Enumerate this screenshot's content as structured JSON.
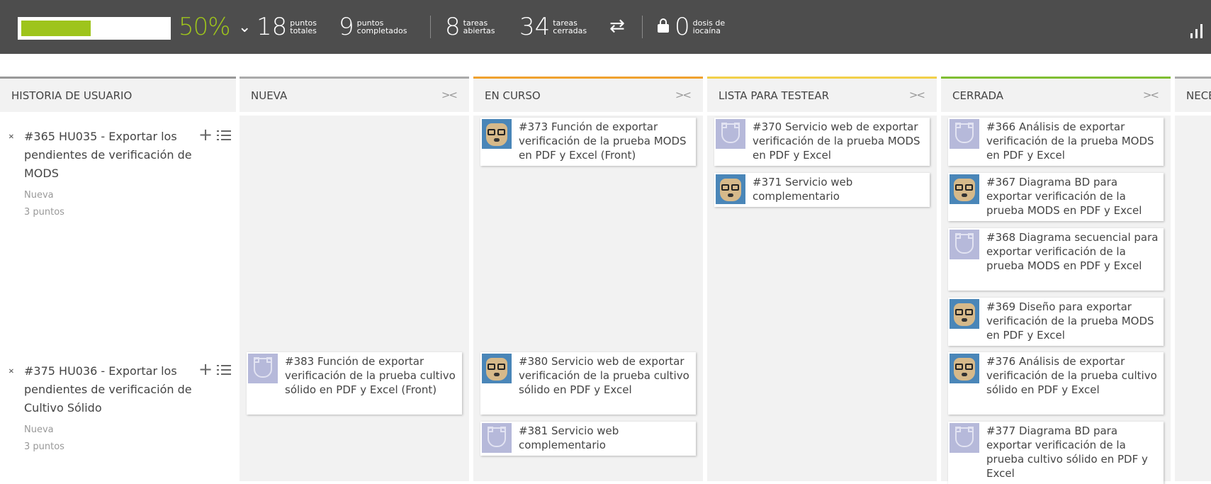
{
  "progress": {
    "percent_label": "50%",
    "fraction": 0.5
  },
  "stats": {
    "total_points": {
      "value": "18",
      "line1": "puntos",
      "line2": "totales"
    },
    "completed_points": {
      "value": "9",
      "line1": "puntos",
      "line2": "completados"
    },
    "open_tasks": {
      "value": "8",
      "line1": "tareas",
      "line2": "abiertas"
    },
    "closed_tasks": {
      "value": "34",
      "line1": "tareas",
      "line2": "cerradas"
    },
    "iocaine": {
      "value": "0",
      "line1": "dosis de",
      "line2": "iocaína"
    }
  },
  "icons": {
    "expand": "chevron-down-icon",
    "swap": "swap-arrows-icon",
    "lock": "lock-icon",
    "graph": "bar-graph-icon",
    "fold": "fold-column-icon",
    "add": "plus-icon",
    "list": "list-icon",
    "toggle": "collapse-toggle-icon"
  },
  "colors": {
    "topbar": "#4d4d4d",
    "progress_green": "#9ec41c",
    "column_bg": "#f2f2f2",
    "nueva_border": "#aaaaaa",
    "en_curso_border": "#f0a22f",
    "lista_border": "#f2d04a",
    "cerrada_border": "#7fbe32"
  },
  "columns": {
    "story": "HISTORIA DE USUARIO",
    "nueva": "NUEVA",
    "en_curso": "EN CURSO",
    "lista": "LISTA PARA TESTEAR",
    "cerrada": "CERRADA",
    "next": "NECE",
    "fold_symbol": "><"
  },
  "stories": [
    {
      "title": "#365 HU035 - Exportar los pendientes de verificación de MODS",
      "status": "Nueva",
      "points": "3 puntos",
      "tasks": {
        "nueva": [],
        "en_curso": [
          {
            "text": "#373 Función de exportar verificación de la prueba MODS en PDF y Excel (Front)",
            "avatar": "dog"
          }
        ],
        "lista": [
          {
            "text": "#370 Servicio web de exportar verificación de la prueba MODS en PDF y Excel",
            "avatar": "default"
          },
          {
            "text": "#371 Servicio web complementario",
            "avatar": "dog"
          }
        ],
        "cerrada": [
          {
            "text": "#366 Análisis de exportar verificación de la prueba MODS en PDF y Excel",
            "avatar": "default"
          },
          {
            "text": "#367 Diagrama BD para exportar verificación de la prueba MODS en PDF y Excel",
            "avatar": "dog"
          },
          {
            "text": "#368 Diagrama secuencial para exportar verificación de la prueba MODS en PDF y Excel",
            "avatar": "default"
          },
          {
            "text": "#369 Diseño para exportar verificación de la prueba MODS en PDF y Excel",
            "avatar": "dog"
          }
        ]
      }
    },
    {
      "title": "#375 HU036 - Exportar los pendientes de verificación de Cultivo Sólido",
      "status": "Nueva",
      "points": "3 puntos",
      "tasks": {
        "nueva": [
          {
            "text": "#383 Función de exportar verificación de la prueba cultivo sólido en PDF y Excel (Front)",
            "avatar": "default"
          }
        ],
        "en_curso": [
          {
            "text": "#380 Servicio web de exportar verificación de la prueba cultivo sólido en PDF y Excel",
            "avatar": "dog"
          },
          {
            "text": "#381 Servicio web complementario",
            "avatar": "default"
          }
        ],
        "lista": [],
        "cerrada": [
          {
            "text": "#376 Análisis de exportar verificación de la prueba cultivo sólido en PDF y Excel",
            "avatar": "dog"
          },
          {
            "text": "#377 Diagrama BD para exportar verificación de la prueba cultivo sólido en PDF y Excel",
            "avatar": "default"
          }
        ]
      }
    }
  ]
}
